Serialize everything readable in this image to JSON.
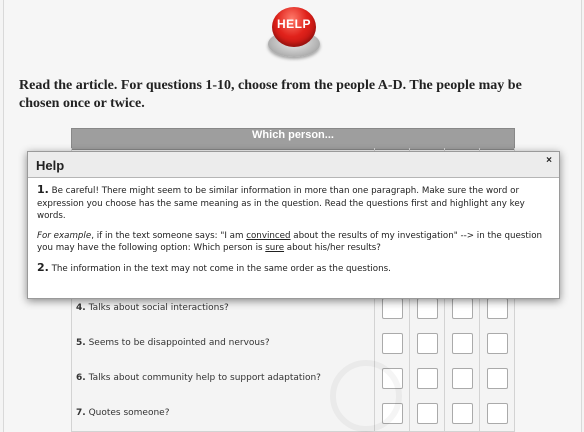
{
  "help_button": {
    "label": "HELP"
  },
  "instruction": "Read the article. For questions 1-10, choose from the people A-D. The people may be chosen once or twice.",
  "table": {
    "header": "Which person...",
    "rows": [
      {
        "num": "4.",
        "text": "Talks about social interactions?"
      },
      {
        "num": "5.",
        "text": "Seems to be disappointed and nervous?"
      },
      {
        "num": "6.",
        "text": "Talks about community help to support adaptation?"
      },
      {
        "num": "7.",
        "text": "Quotes someone?"
      }
    ]
  },
  "dialog": {
    "title": "Help",
    "close": "×",
    "p1_num": "1.",
    "p1_text": " Be careful! There might seem to be similar information in more than one paragraph. Make sure the word or expression you choose has the same meaning as in the question. Read the questions first and highlight any key words.",
    "ex_italic": "For example",
    "ex_text1": ", if in the text someone says: \"I am ",
    "ex_u1": "convinced",
    "ex_text2": " about the results of my investigation\" --> in the question you may have the following option: Which person is ",
    "ex_u2": "sure",
    "ex_text3": " about his/her results?",
    "p2_num": "2.",
    "p2_text": " The information in the text may not come in the same order as the questions."
  }
}
